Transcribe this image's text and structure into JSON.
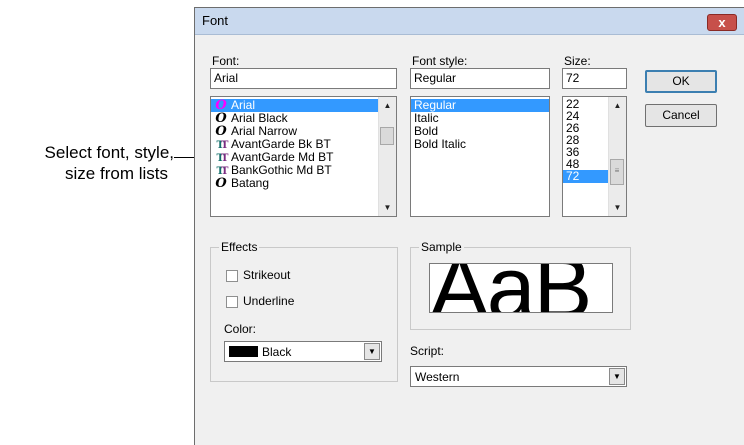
{
  "callout": {
    "line1": "Select font, style,",
    "line2": "size from lists"
  },
  "dialog": {
    "title": "Font",
    "close_glyph": "x"
  },
  "font": {
    "label": "Font:",
    "value": "Arial",
    "items": [
      {
        "name": "Arial",
        "icon": "opentype-icon",
        "selected": true
      },
      {
        "name": "Arial Black",
        "icon": "opentype-icon"
      },
      {
        "name": "Arial Narrow",
        "icon": "opentype-icon"
      },
      {
        "name": "AvantGarde Bk BT",
        "icon": "truetype-icon"
      },
      {
        "name": "AvantGarde Md BT",
        "icon": "truetype-icon"
      },
      {
        "name": "BankGothic Md BT",
        "icon": "truetype-icon"
      },
      {
        "name": "Batang",
        "icon": "opentype-icon"
      }
    ]
  },
  "style": {
    "label": "Font style:",
    "value": "Regular",
    "items": [
      "Regular",
      "Italic",
      "Bold",
      "Bold Italic"
    ]
  },
  "size": {
    "label": "Size:",
    "value": "72",
    "items": [
      "22",
      "24",
      "26",
      "28",
      "36",
      "48",
      "72"
    ]
  },
  "buttons": {
    "ok": "OK",
    "cancel": "Cancel"
  },
  "effects": {
    "label": "Effects",
    "strikeout": "Strikeout",
    "underline": "Underline",
    "color_label": "Color:",
    "color_value": "Black",
    "color_hex": "#000000"
  },
  "sample": {
    "label": "Sample",
    "text": "AaB"
  },
  "script": {
    "label": "Script:",
    "value": "Western"
  }
}
